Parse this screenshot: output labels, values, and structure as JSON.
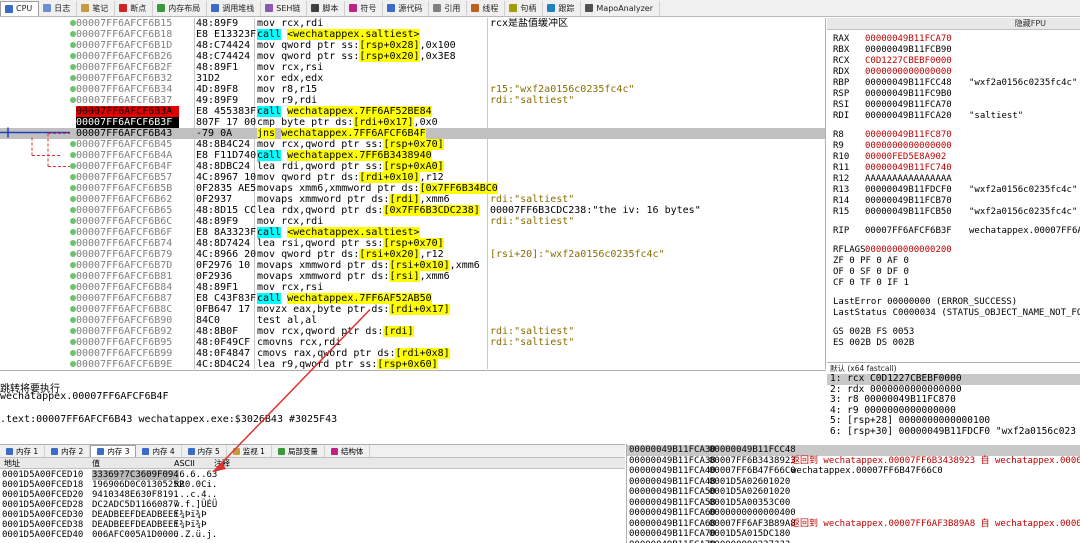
{
  "tabs": [
    {
      "label": "CPU",
      "icon": "cpu-icon",
      "color": "#3a6bc8",
      "active": true
    },
    {
      "label": "日志",
      "icon": "log-icon",
      "color": "#6a8fd0"
    },
    {
      "label": "笔记",
      "icon": "notes-icon",
      "color": "#c89a40"
    },
    {
      "label": "断点",
      "icon": "breakpoint-icon",
      "color": "#d02020"
    },
    {
      "label": "内存布局",
      "icon": "memory-map-icon",
      "color": "#3a9a3a"
    },
    {
      "label": "调用堆栈",
      "icon": "call-stack-icon",
      "color": "#3a6bc8"
    },
    {
      "label": "SEH链",
      "icon": "seh-icon",
      "color": "#8a5ab0"
    },
    {
      "label": "脚本",
      "icon": "script-icon",
      "color": "#404040"
    },
    {
      "label": "符号",
      "icon": "symbols-icon",
      "color": "#c02080"
    },
    {
      "label": "源代码",
      "icon": "source-icon",
      "color": "#3a6bc8"
    },
    {
      "label": "引用",
      "icon": "references-icon",
      "color": "#808080"
    },
    {
      "label": "线程",
      "icon": "threads-icon",
      "color": "#c06020"
    },
    {
      "label": "句柄",
      "icon": "handles-icon",
      "color": "#a0a000"
    },
    {
      "label": "跟踪",
      "icon": "trace-icon",
      "color": "#2080c0"
    },
    {
      "label": "MapoAnalyzer",
      "icon": "plugin-icon",
      "color": "#505050"
    }
  ],
  "disasm": [
    {
      "addr": "00007FF6AFCF6B15",
      "bytes": "48:89F9",
      "instr": "mov rcx,rdi",
      "comment": "rcx是盐值缓冲区",
      "bp": true
    },
    {
      "addr": "00007FF6AFCF6B18",
      "bytes": "E8 E13323F",
      "instr": "call <wechatappex.saltiest>",
      "bp": true
    },
    {
      "addr": "00007FF6AFCF6B1D",
      "bytes": "48:C74424",
      "instr": "mov qword ptr ss:[rsp+0x28],0x100",
      "bp": true
    },
    {
      "addr": "00007FF6AFCF6B26",
      "bytes": "48:C74424",
      "instr": "mov qword ptr ss:[rsp+0x20],0x3E8",
      "bp": true
    },
    {
      "addr": "00007FF6AFCF6B2F",
      "bytes": "48:89F1",
      "instr": "mov rcx,rsi",
      "bp": true
    },
    {
      "addr": "00007FF6AFCF6B32",
      "bytes": "31D2",
      "instr": "xor edx,edx",
      "bp": true
    },
    {
      "addr": "00007FF6AFCF6B34",
      "bytes": "4D:89F8",
      "instr": "mov r8,r15",
      "comment": "r15:\"wxf2a0156c0235fc4c\"",
      "bp": true
    },
    {
      "addr": "00007FF6AFCF6B37",
      "bytes": "49:89F9",
      "instr": "mov r9,rdi",
      "comment": "rdi:\"saltiest\"",
      "bp": true
    },
    {
      "addr": "00007FF6AFCF6B3A",
      "bytes": "E8 455383F",
      "instr": "call wechatappex.7FF6AF52BE84",
      "style": "red"
    },
    {
      "addr": "00007FF6AFCF6B3F",
      "bytes": "807F 17 00",
      "instr": "cmp byte ptr ds:[rdi+0x17],0x0",
      "style": "black"
    },
    {
      "addr": "00007FF6AFCF6B43",
      "bytes": "-79 0A",
      "instr": "jns wechatappex.7FF6AFCF6B4F",
      "style": "current"
    },
    {
      "addr": "00007FF6AFCF6B45",
      "bytes": "48:8B4C24",
      "instr": "mov rcx,qword ptr ss:[rsp+0x70]",
      "bp": true
    },
    {
      "addr": "00007FF6AFCF6B4A",
      "bytes": "E8 F11D740",
      "instr": "call wechatappex.7FF6B3438940",
      "bp": true
    },
    {
      "addr": "00007FF6AFCF6B4F",
      "bytes": "48:8DBC24",
      "instr": "lea rdi,qword ptr ss:[rsp+0xA0]",
      "bp": true
    },
    {
      "addr": "00007FF6AFCF6B57",
      "bytes": "4C:8967 10",
      "instr": "mov qword ptr ds:[rdi+0x10],r12",
      "bp": true
    },
    {
      "addr": "00007FF6AFCF6B5B",
      "bytes": "0F2835 AE5",
      "instr": "movaps xmm6,xmmword ptr ds:[0x7FF6B34BC0",
      "bp": true
    },
    {
      "addr": "00007FF6AFCF6B62",
      "bytes": "0F2937",
      "instr": "movaps xmmword ptr ds:[rdi],xmm6",
      "comment": "rdi:\"saltiest\"",
      "bp": true
    },
    {
      "addr": "00007FF6AFCF6B65",
      "bytes": "48:8D15 CC",
      "instr": "lea rdx,qword ptr ds:[0x7FF6B3CDC238]",
      "comment": "00007FF6B3CDC238:\"the iv: 16 bytes\"",
      "bp": true
    },
    {
      "addr": "00007FF6AFCF6B6C",
      "bytes": "48:89F9",
      "instr": "mov rcx,rdi",
      "comment": "rdi:\"saltiest\"",
      "bp": true
    },
    {
      "addr": "00007FF6AFCF6B6F",
      "bytes": "E8 8A3323F",
      "instr": "call <wechatappex.saltiest>",
      "bp": true
    },
    {
      "addr": "00007FF6AFCF6B74",
      "bytes": "48:8D7424",
      "instr": "lea rsi,qword ptr ss:[rsp+0x70]",
      "bp": true
    },
    {
      "addr": "00007FF6AFCF6B79",
      "bytes": "4C:8966 20",
      "instr": "mov qword ptr ds:[rsi+0x20],r12",
      "comment": "[rsi+20]:\"wxf2a0156c0235fc4c\"",
      "bp": true
    },
    {
      "addr": "00007FF6AFCF6B7D",
      "bytes": "0F2976 10",
      "instr": "movaps xmmword ptr ds:[rsi+0x10],xmm6",
      "bp": true
    },
    {
      "addr": "00007FF6AFCF6B81",
      "bytes": "0F2936",
      "instr": "movaps xmmword ptr ds:[rsi],xmm6",
      "bp": true
    },
    {
      "addr": "00007FF6AFCF6B84",
      "bytes": "48:89F1",
      "instr": "mov rcx,rsi",
      "bp": true
    },
    {
      "addr": "00007FF6AFCF6B87",
      "bytes": "E8 C43F83F",
      "instr": "call wechatappex.7FF6AF52AB50",
      "bp": true
    },
    {
      "addr": "00007FF6AFCF6B8C",
      "bytes": "0FB647 17",
      "instr": "movzx eax,byte ptr ds:[rdi+0x17]",
      "bp": true
    },
    {
      "addr": "00007FF6AFCF6B90",
      "bytes": "84C0",
      "instr": "test al,al",
      "bp": true
    },
    {
      "addr": "00007FF6AFCF6B92",
      "bytes": "48:8B0F",
      "instr": "mov rcx,qword ptr ds:[rdi]",
      "comment": "rdi:\"saltiest\"",
      "bp": true
    },
    {
      "addr": "00007FF6AFCF6B95",
      "bytes": "48:0F49CF",
      "instr": "cmovns rcx,rdi",
      "comment": "rdi:\"saltiest\"",
      "bp": true
    },
    {
      "addr": "00007FF6AFCF6B99",
      "bytes": "48:0F4847",
      "instr": "cmovs rax,qword ptr ds:[rdi+0x8]",
      "bp": true
    },
    {
      "addr": "00007FF6AFCF6B9E",
      "bytes": "4C:8D4C24",
      "instr": "lea r9,qword ptr ss:[rsp+0x60]",
      "bp": true
    }
  ],
  "registers": {
    "header": "隐藏FPU",
    "general": [
      {
        "name": "RAX",
        "value": "00000049B11FCA70",
        "changed": true
      },
      {
        "name": "RBX",
        "value": "00000049B11FCB90"
      },
      {
        "name": "RCX",
        "value": "C0D1227CBEBF0000",
        "changed": true
      },
      {
        "name": "RDX",
        "value": "0000000000000000",
        "changed": true
      },
      {
        "name": "RBP",
        "value": "00000049B11FCC48",
        "comment": "\"wxf2a0156c0235fc4c\""
      },
      {
        "name": "RSP",
        "value": "00000049B11FC9B0"
      },
      {
        "name": "RSI",
        "value": "00000049B11FCA70"
      },
      {
        "name": "RDI",
        "value": "00000049B11FCA20",
        "comment": "\"saltiest\""
      }
    ],
    "extended": [
      {
        "name": "R8",
        "value": "00000049B11FC870",
        "changed": true
      },
      {
        "name": "R9",
        "value": "0000000000000000",
        "changed": true
      },
      {
        "name": "R10",
        "value": "00000FED5E8A902",
        "changed": true
      },
      {
        "name": "R11",
        "value": "00000049B11FC740",
        "changed": true
      },
      {
        "name": "R12",
        "value": "AAAAAAAAAAAAAAAA"
      },
      {
        "name": "R13",
        "value": "00000049B11FDCF0",
        "comment": "\"wxf2a0156c0235fc4c\""
      },
      {
        "name": "R14",
        "value": "00000049B11FCB70"
      },
      {
        "name": "R15",
        "value": "00000049B11FCB50",
        "comment": "\"wxf2a0156c0235fc4c\""
      }
    ],
    "rip": {
      "name": "RIP",
      "value": "00007FF6AFCF6B3F",
      "comment": "wechatappex.00007FF6AFC"
    },
    "rflags": {
      "name": "RFLAGS",
      "value": "0000000000000200"
    },
    "flags": [
      "ZF 0  PF 0  AF 0",
      "OF 0  SF 0  DF 0",
      "CF 0  TF 0  IF 1"
    ],
    "last_error": "LastError  00000000 (ERROR_SUCCESS)",
    "last_status": "LastStatus C0000034 (STATUS_OBJECT_NAME_NOT_FOUND)",
    "segments": [
      "GS 002B  FS 0053",
      "ES 002B  DS 002B"
    ]
  },
  "call_args": {
    "header": "默认 (x64 fastcall)",
    "rows": [
      "1: rcx C0D1227CBEBF0000",
      "2: rdx 0000000000000000",
      "3: r8 00000049B11FC870",
      "4: r9 0000000000000000",
      "5: [rsp+28] 0000000000000100",
      "6: [rsp+30] 00000049B11FDCF0 \"wxf2a0156c023"
    ]
  },
  "info": {
    "line1": "跳转将要执行",
    "line2": "wechatappex.00007FF6AFCF6B4F",
    "line3": ".text:00007FF6AFCF6B43 wechatappex.exe:$3026B43 #3025F43"
  },
  "bottom_tabs": [
    {
      "label": "内存 1",
      "icon": "dump-icon"
    },
    {
      "label": "内存 2",
      "icon": "dump-icon"
    },
    {
      "label": "内存 3",
      "icon": "dump-icon",
      "active": true
    },
    {
      "label": "内存 4",
      "icon": "dump-icon"
    },
    {
      "label": "内存 5",
      "icon": "dump-icon"
    },
    {
      "label": "监视 1",
      "icon": "watch-icon"
    },
    {
      "label": "局部变量",
      "icon": "locals-icon"
    },
    {
      "label": "结构体",
      "icon": "struct-icon"
    }
  ],
  "dump": {
    "col_addr": "地址",
    "col_hex": "值",
    "col_ascii": "ASCII",
    "col_comment": "注释",
    "rows": [
      {
        "addr": "0001D5A00FCED10",
        "hex": "33369?7C3609F094",
        "ascii": ".6.6..63",
        "selected": true
      },
      {
        "addr": "0001D5A00FCED18",
        "hex": "196906D0C01305252",
        "ascii": "RR0.0Ci."
      },
      {
        "addr": "0001D5A00FCED20",
        "hex": "9410348E630F8191",
        "ascii": "...c.4.."
      },
      {
        "addr": "0001D5A00FCED28",
        "hex": "DC2ADC5D11660877",
        "ascii": "w.f.]ÜÉÜ"
      },
      {
        "addr": "0001D5A00FCED30",
        "hex": "DEADBEEFDEADBEEF",
        "ascii": "ï¾­Þï¾­Þ"
      },
      {
        "addr": "0001D5A00FCED38",
        "hex": "DEADBEEFDEADBEEF",
        "ascii": "ï¾­Þï¾­Þ"
      },
      {
        "addr": "0001D5A00FCED40",
        "hex": "006AFC005A1D0000",
        "ascii": "..Z.ü.j."
      }
    ]
  },
  "stack": [
    {
      "addr": "00000049B11FCA30",
      "val": "00000049B11FCC48",
      "cmt": "",
      "cur": true
    },
    {
      "addr": "00000049B11FCA38",
      "val": "00007FF6B3438923",
      "cmt": "返回到 wechatappex.00007FF6B3438923 自 wechatappex.00007FF6",
      "red": true
    },
    {
      "addr": "00000049B11FCA40",
      "val": "00007FF6B47F66C0",
      "cmt": "wechatappex.00007FF6B47F66C0"
    },
    {
      "addr": "00000049B11FCA48",
      "val": "0001D5A02601020",
      "cmt": ""
    },
    {
      "addr": "00000049B11FCA50",
      "val": "0001D5A02601020",
      "cmt": ""
    },
    {
      "addr": "00000049B11FCA58",
      "val": "0001D5A00353C00",
      "cmt": ""
    },
    {
      "addr": "00000049B11FCA60",
      "val": "0000000000000400",
      "cmt": ""
    },
    {
      "addr": "00000049B11FCA68",
      "val": "00007FF6AF3B89A8",
      "cmt": "返回到 wechatappex.00007FF6AF3B89A8 自 wechatappex.00007FF6",
      "red": true
    },
    {
      "addr": "00000049B11FCA70",
      "val": "0001D5A015DC180",
      "cmt": ""
    },
    {
      "addr": "00000049B11FCA78",
      "val": "000000000237???",
      "cmt": ""
    }
  ],
  "colors": {
    "call_highlight": "#00ffff",
    "target_highlight": "#ffff00",
    "breakpoint_red": "#e00000",
    "changed_register": "#c00000",
    "current_row": "#c0c0c0",
    "arrow_red": "#e03030"
  }
}
